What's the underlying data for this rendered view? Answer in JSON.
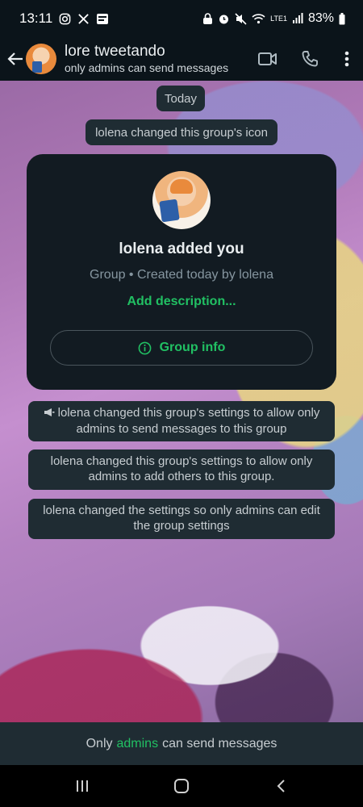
{
  "status_bar": {
    "time": "13:11",
    "battery": "83%",
    "network": "LTE1",
    "icons": [
      "instagram-icon",
      "x-icon",
      "notification-icon",
      "lock-icon",
      "alarm-icon",
      "mute-icon",
      "wifi-icon",
      "signal-icon",
      "battery-icon"
    ]
  },
  "header": {
    "title": "lore tweetando",
    "subtitle": "only admins can send messages"
  },
  "chat": {
    "date_label": "Today",
    "icon_changed": "lolena changed this group's icon",
    "card": {
      "title": "lolena added you",
      "subtitle": "Group • Created today by lolena",
      "add_description": "Add description...",
      "group_info": "Group info"
    },
    "system_messages": [
      "lolena changed this group's settings to allow only admins to send messages to this group",
      "lolena changed this group's settings to allow only admins to add others to this group.",
      "lolena changed the settings so only admins can edit the group settings"
    ]
  },
  "footer": {
    "prefix": "Only",
    "highlight": "admins",
    "suffix": "can send messages"
  },
  "colors": {
    "accent": "#21c063",
    "background": "#0b141a",
    "card": "#121b22",
    "chip": "#1f2c33"
  }
}
